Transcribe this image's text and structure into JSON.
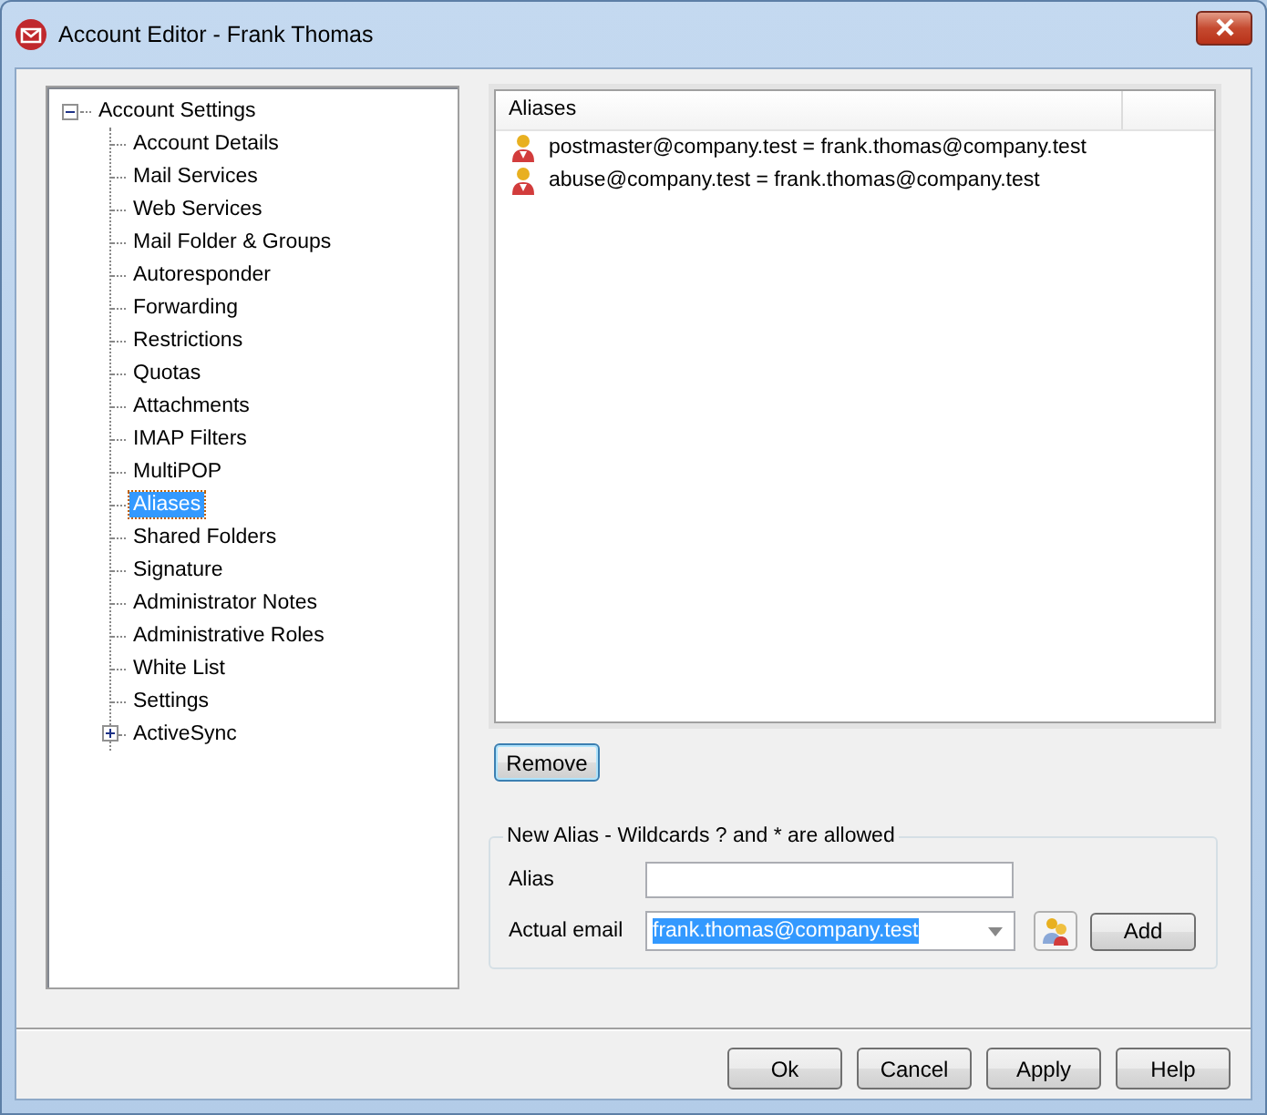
{
  "window": {
    "title": "Account Editor - Frank Thomas"
  },
  "tree": {
    "label": "Account Settings",
    "expanded": true,
    "children": [
      {
        "label": "Account Details",
        "selected": false
      },
      {
        "label": "Mail Services",
        "selected": false
      },
      {
        "label": "Web Services",
        "selected": false
      },
      {
        "label": "Mail Folder & Groups",
        "selected": false
      },
      {
        "label": "Autoresponder",
        "selected": false
      },
      {
        "label": "Forwarding",
        "selected": false
      },
      {
        "label": "Restrictions",
        "selected": false
      },
      {
        "label": "Quotas",
        "selected": false
      },
      {
        "label": "Attachments",
        "selected": false
      },
      {
        "label": "IMAP Filters",
        "selected": false
      },
      {
        "label": "MultiPOP",
        "selected": false
      },
      {
        "label": "Aliases",
        "selected": true
      },
      {
        "label": "Shared Folders",
        "selected": false
      },
      {
        "label": "Signature",
        "selected": false
      },
      {
        "label": "Administrator Notes",
        "selected": false
      },
      {
        "label": "Administrative Roles",
        "selected": false
      },
      {
        "label": "White List",
        "selected": false
      },
      {
        "label": "Settings",
        "selected": false
      },
      {
        "label": "ActiveSync",
        "selected": false,
        "expanded": false
      }
    ]
  },
  "aliases": {
    "header": "Aliases",
    "rows": [
      {
        "text": "postmaster@company.test = frank.thomas@company.test"
      },
      {
        "text": "abuse@company.test = frank.thomas@company.test"
      }
    ]
  },
  "remove_button": "Remove",
  "new_alias": {
    "legend": "New Alias - Wildcards ? and * are allowed",
    "alias_label": "Alias",
    "email_label": "Actual email",
    "email_value": "frank.thomas@company.test",
    "email_highlighted": true,
    "add_button": "Add"
  },
  "buttons": [
    "Ok",
    "Cancel",
    "Apply",
    "Help"
  ]
}
